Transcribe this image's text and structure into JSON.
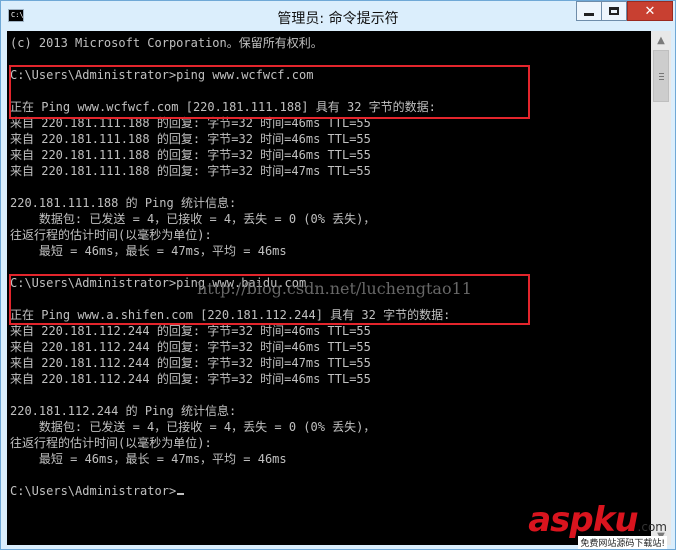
{
  "window": {
    "title": "管理员: 命令提示符",
    "icon_text": "C:\\",
    "controls": {
      "minimize": "minimize-icon",
      "maximize": "maximize-icon",
      "close": "close-icon"
    }
  },
  "console": {
    "lines": [
      "(c) 2013 Microsoft Corporation。保留所有权利。",
      "",
      "C:\\Users\\Administrator>ping www.wcfwcf.com",
      "",
      "正在 Ping www.wcfwcf.com [220.181.111.188] 具有 32 字节的数据:",
      "来自 220.181.111.188 的回复: 字节=32 时间=46ms TTL=55",
      "来自 220.181.111.188 的回复: 字节=32 时间=46ms TTL=55",
      "来自 220.181.111.188 的回复: 字节=32 时间=46ms TTL=55",
      "来自 220.181.111.188 的回复: 字节=32 时间=47ms TTL=55",
      "",
      "220.181.111.188 的 Ping 统计信息:",
      "    数据包: 已发送 = 4，已接收 = 4，丢失 = 0 (0% 丢失)，",
      "往返行程的估计时间(以毫秒为单位):",
      "    最短 = 46ms，最长 = 47ms，平均 = 46ms",
      "",
      "C:\\Users\\Administrator>ping www.baidu.com",
      "",
      "正在 Ping www.a.shifen.com [220.181.112.244] 具有 32 字节的数据:",
      "来自 220.181.112.244 的回复: 字节=32 时间=46ms TTL=55",
      "来自 220.181.112.244 的回复: 字节=32 时间=46ms TTL=55",
      "来自 220.181.112.244 的回复: 字节=32 时间=47ms TTL=55",
      "来自 220.181.112.244 的回复: 字节=32 时间=46ms TTL=55",
      "",
      "220.181.112.244 的 Ping 统计信息:",
      "    数据包: 已发送 = 4，已接收 = 4，丢失 = 0 (0% 丢失)，",
      "往返行程的估计时间(以毫秒为单位):",
      "    最短 = 46ms，最长 = 47ms，平均 = 46ms",
      "",
      "C:\\Users\\Administrator>"
    ],
    "watermark": "http://blog.csdn.net/luchengtao11"
  },
  "logo": {
    "text_a": "asp",
    "text_b": "ku",
    "domain": ".com",
    "tagline": "免费网站源码下载站!"
  },
  "colors": {
    "highlight": "#e3252c",
    "console_bg": "#000000",
    "console_text": "#c0c0c0",
    "brand": "#d9141e"
  }
}
